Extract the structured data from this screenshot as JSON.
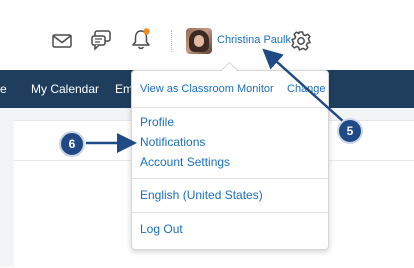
{
  "header": {
    "user_name": "Christina Paulk",
    "icons": [
      "envelope-icon",
      "chat-icon",
      "bell-icon",
      "gear-icon"
    ],
    "notification_dot_color": "#f08a24"
  },
  "nav": {
    "items": [
      {
        "label": "e"
      },
      {
        "label": "My Calendar"
      },
      {
        "label": "Em"
      }
    ]
  },
  "user_menu": {
    "view_as_label": "View as Classroom Monitor",
    "change_label": "Change",
    "profile_label": "Profile",
    "notifications_label": "Notifications",
    "account_settings_label": "Account Settings",
    "language_label": "English (United States)",
    "logout_label": "Log Out"
  },
  "annotations": {
    "marker_5": "5",
    "marker_6": "6"
  },
  "colors": {
    "nav_bg": "#1f3e5e",
    "link": "#1a6fc1",
    "marker": "#1f4a86"
  }
}
